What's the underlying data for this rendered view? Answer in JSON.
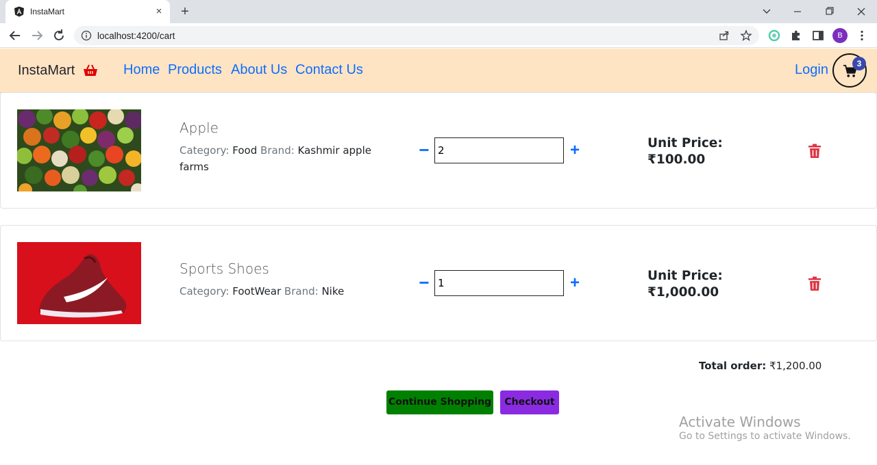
{
  "browser": {
    "tab_title": "InstaMart",
    "tab_close": "×",
    "new_tab": "+",
    "url": "localhost:4200/cart",
    "profile_initial": "B"
  },
  "navbar": {
    "brand": "InstaMart",
    "links": [
      "Home",
      "Products",
      "About Us",
      "Contact Us"
    ],
    "login": "Login",
    "cart_count": "3"
  },
  "cart": {
    "items": [
      {
        "name": "Apple",
        "category_label": "Category:",
        "category": "Food",
        "brand_label": "Brand:",
        "brand": "Kashmir apple farms",
        "quantity": "2",
        "unit_price_label": "Unit Price:",
        "unit_price": "₹100.00"
      },
      {
        "name": "Sports Shoes",
        "category_label": "Category:",
        "category": "FootWear",
        "brand_label": "Brand:",
        "brand": "Nike",
        "quantity": "1",
        "unit_price_label": "Unit Price:",
        "unit_price": "₹1,000.00"
      }
    ],
    "total_label": "Total order:",
    "total_value": "₹1,200.00",
    "continue_label": "Continue Shopping",
    "checkout_label": "Checkout"
  },
  "watermark": {
    "title": "Activate Windows",
    "subtitle": "Go to Settings to activate Windows."
  },
  "icons": {
    "minus": "−",
    "plus": "+"
  },
  "colors": {
    "navbar_bg": "#ffe4c4",
    "link": "#0d6efd",
    "continue_bg": "#008000",
    "checkout_bg": "#8a2be2",
    "trash": "#dc3545"
  }
}
